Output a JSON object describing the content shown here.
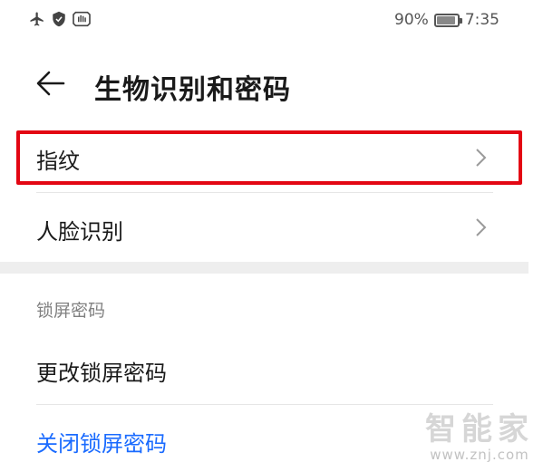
{
  "status_bar": {
    "battery_text": "90%",
    "battery_level": 0.9,
    "time": "7:35",
    "icons": [
      "airplane-icon",
      "shield-icon",
      "hand-icon"
    ]
  },
  "header": {
    "back_icon": "arrow-left-icon",
    "title": "生物识别和密码"
  },
  "items": {
    "fingerprint": {
      "label": "指纹",
      "icon": "chevron-right-icon"
    },
    "face_recognition": {
      "label": "人脸识别",
      "icon": "chevron-right-icon"
    }
  },
  "lock_section": {
    "header": "锁屏密码",
    "change_password": "更改锁屏密码",
    "disable_password": "关闭锁屏密码"
  },
  "colors": {
    "highlight": "#e30613",
    "link": "#1a6bff",
    "section_bg": "#eeeeee"
  },
  "watermark": {
    "logo": "智能家",
    "url": "www.znj.com"
  }
}
